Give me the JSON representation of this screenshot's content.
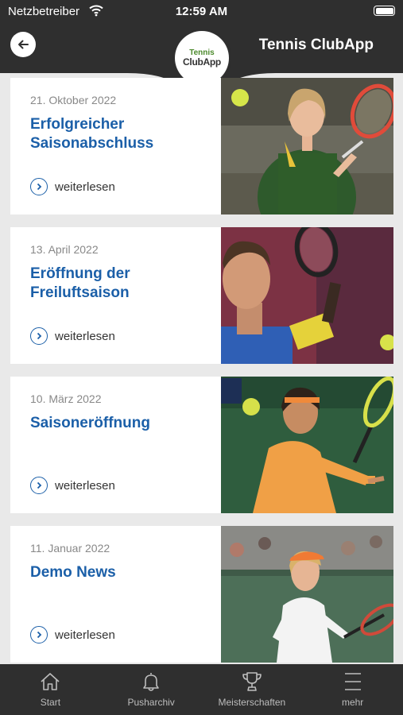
{
  "status_bar": {
    "carrier": "Netzbetreiber",
    "time": "12:59 AM"
  },
  "header": {
    "title": "Tennis ClubApp",
    "logo": {
      "line1": "Tennis",
      "line2": "ClubApp",
      "line3": ""
    }
  },
  "news": [
    {
      "date": "21. Oktober 2022",
      "title": "Erfolgreicher Saisonabschluss",
      "more": "weiterlesen",
      "image": "female-tennis-player-photo"
    },
    {
      "date": "13. April 2022",
      "title": "Eröffnung der Freiluftsaison",
      "more": "weiterlesen",
      "image": "male-tennis-player-photo"
    },
    {
      "date": "10. März 2022",
      "title": "Saisoneröffnung",
      "more": "weiterlesen",
      "image": "tennis-player-orange-shirt-photo"
    },
    {
      "date": "11. Januar 2022",
      "title": "Demo News",
      "more": "weiterlesen",
      "image": "female-player-white-outfit-photo"
    }
  ],
  "tabs": [
    {
      "label": "Start",
      "icon": "home-icon"
    },
    {
      "label": "Pusharchiv",
      "icon": "bell-icon"
    },
    {
      "label": "Meisterschaften",
      "icon": "trophy-icon"
    },
    {
      "label": "mehr",
      "icon": "menu-icon"
    }
  ],
  "colors": {
    "bar": "#2f2f2f",
    "accent": "#1b5fa8",
    "background": "#e9e9e9"
  }
}
